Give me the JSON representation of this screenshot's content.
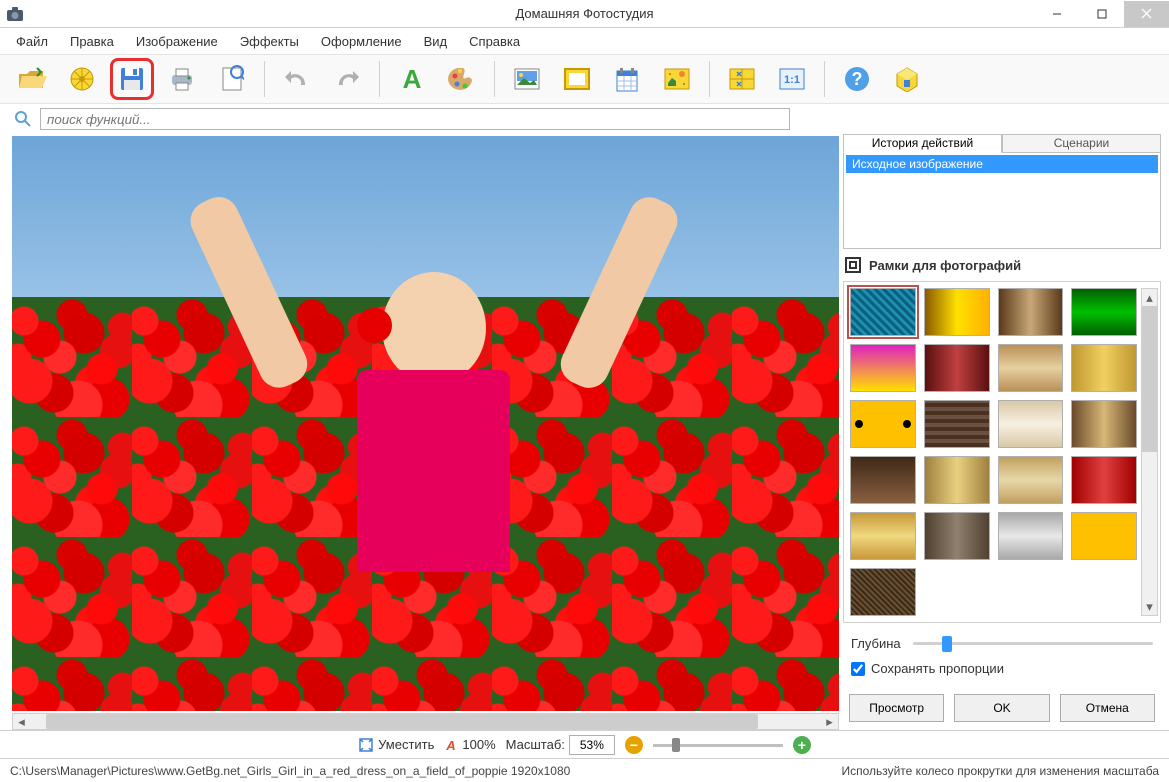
{
  "window": {
    "title": "Домашняя Фотостудия"
  },
  "menu": {
    "items": [
      "Файл",
      "Правка",
      "Изображение",
      "Эффекты",
      "Оформление",
      "Вид",
      "Справка"
    ]
  },
  "search": {
    "placeholder": "поиск функций..."
  },
  "history": {
    "tab_history": "История действий",
    "tab_scenarios": "Сценарии",
    "items": [
      "Исходное изображение"
    ]
  },
  "frames": {
    "title": "Рамки для фотографий",
    "depth_label": "Глубина",
    "keep_proportions": "Сохранять пропорции"
  },
  "actions": {
    "preview": "Просмотр",
    "ok": "OK",
    "cancel": "Отмена"
  },
  "zoom": {
    "fit_label": "Уместить",
    "hundred_label": "100%",
    "scale_label": "Масштаб:",
    "value": "53%"
  },
  "status": {
    "path": "C:\\Users\\Manager\\Pictures\\www.GetBg.net_Girls_Girl_in_a_red_dress_on_a_field_of_poppie 1920x1080",
    "hint": "Используйте колесо прокрутки для изменения масштаба"
  }
}
